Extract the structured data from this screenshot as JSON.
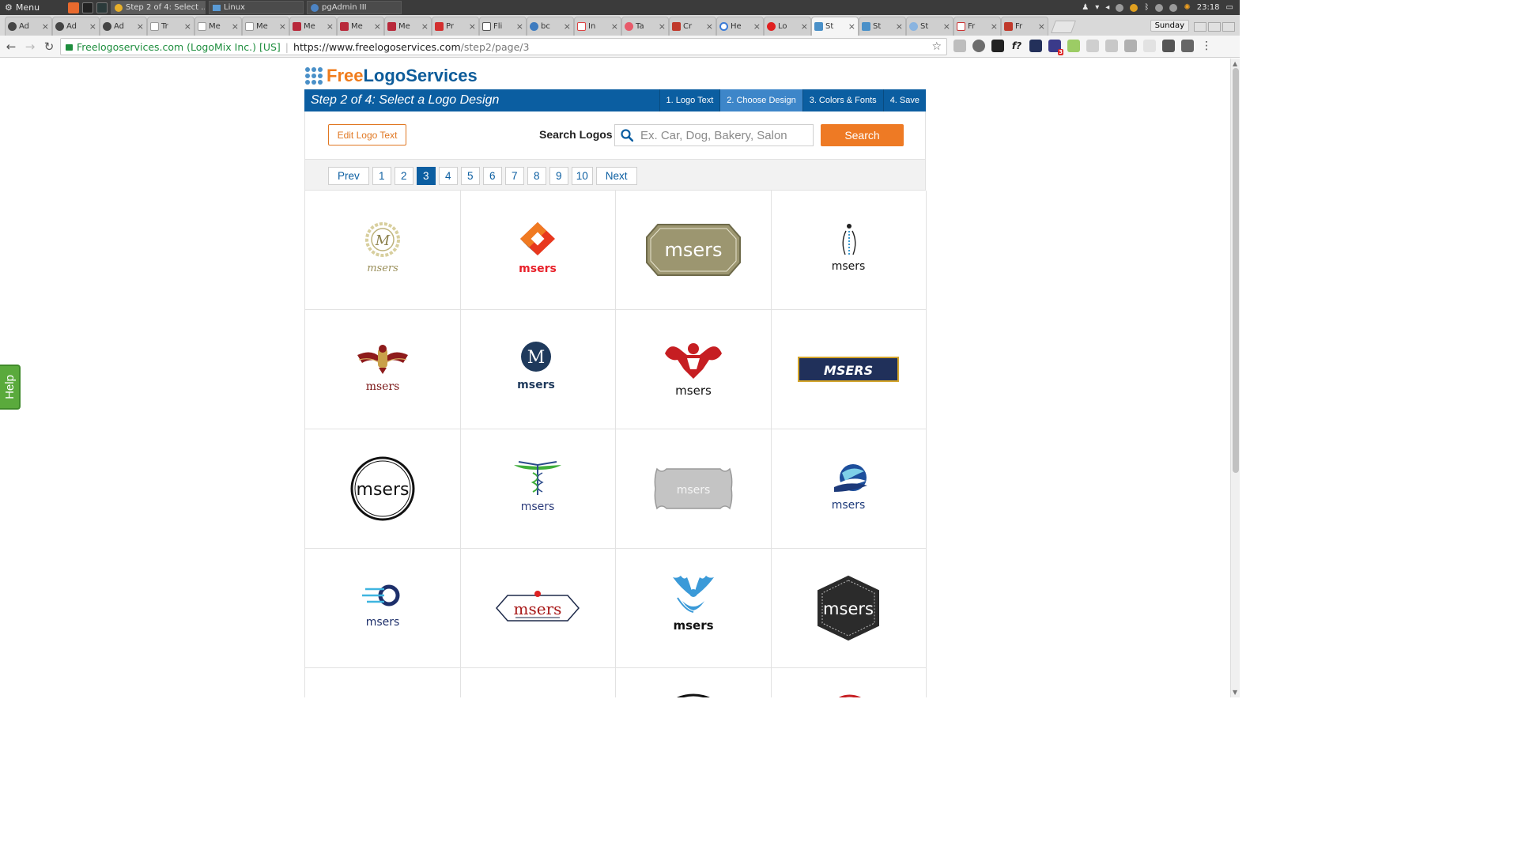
{
  "os": {
    "menu_label": "Menu",
    "tasks": [
      "Step 2 of 4: Select ...",
      "Linux",
      "pgAdmin III"
    ],
    "day_label": "Sunday",
    "clock": "23:18"
  },
  "browser": {
    "tabs": [
      "Ad",
      "Ad",
      "Ad",
      "Tr",
      "Me",
      "Me",
      "Me",
      "Me",
      "Me",
      "Pr",
      "Fli",
      "bc",
      "In",
      "Ta",
      "Cr",
      "He",
      "Lo",
      "St",
      "St",
      "St",
      "Fr",
      "Fr"
    ],
    "active_tab_index": 17,
    "site_identity": "Freelogoservices.com (LogoMix Inc.) [US]",
    "url_host": "https://www.freelogoservices.com",
    "url_path": "/step2/page/3",
    "ext_badge": "3"
  },
  "site": {
    "brand_free": "Free",
    "brand_rest": "LogoServices",
    "step_title": "Step 2 of 4: Select a Logo Design",
    "steps": [
      "1. Logo Text",
      "2. Choose Design",
      "3. Colors & Fonts",
      "4. Save"
    ],
    "current_step": 1,
    "edit_label": "Edit Logo Text",
    "search_label": "Search Logos",
    "search_placeholder": "Ex. Car, Dog, Bakery, Salon",
    "search_button": "Search",
    "pager_prev": "Prev",
    "pager_pages": [
      "1",
      "2",
      "3",
      "4",
      "5",
      "6",
      "7",
      "8",
      "9",
      "10"
    ],
    "pager_current": "3",
    "pager_next": "Next",
    "logo_text": "msers",
    "logo_text_upper": "MSERS",
    "monogram": "M",
    "help_label": "Help"
  },
  "colors": {
    "brand_orange": "#ee7a24",
    "brand_blue": "#0b5ea1",
    "step_current": "#3d86c9",
    "help_green": "#5aaa3c"
  }
}
